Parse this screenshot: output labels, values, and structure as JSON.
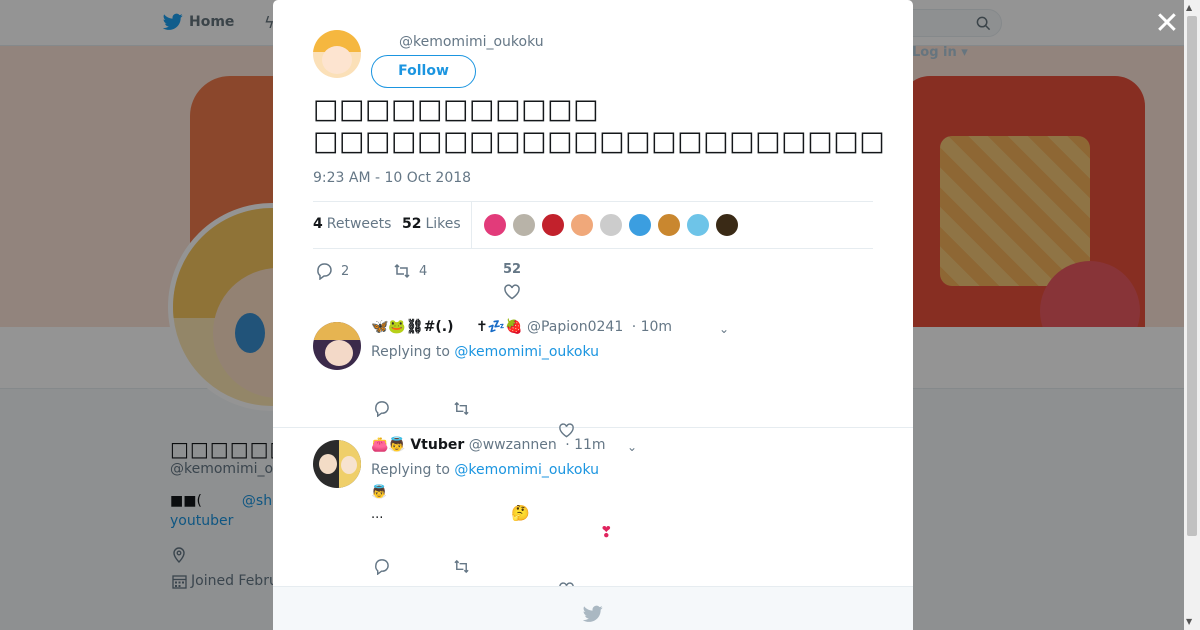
{
  "topbar": {
    "home_label": "Home",
    "login_label": "Log in"
  },
  "profile": {
    "name": "□□□□□□□□□□□",
    "handle": "@kemomimi_o",
    "bio_start": "■■(",
    "bio_link": "@she",
    "bio_line2": "youtuber",
    "joined": "Joined Febru"
  },
  "tweet": {
    "handle": "@kemomimi_oukoku",
    "follow_label": "Follow",
    "text": "□□□□□□□□□□□\n□□□□□□□□□□□□□□□□□□□□□□",
    "timestamp": "9:23 AM - 10 Oct 2018",
    "retweets_count": "4",
    "retweets_label": "Retweets",
    "likes_count": "52",
    "likes_label": "Likes",
    "liker_colors": [
      "#e23b7a",
      "#b8b3a8",
      "#c2212c",
      "#f0a87a",
      "#cccccc",
      "#3b9ee0",
      "#c9872f",
      "#6ec4e8",
      "#3a2a16"
    ],
    "actions": {
      "reply_count": "2",
      "retweet_count": "4",
      "like_count": "52"
    }
  },
  "replies": [
    {
      "name_emoji": "🦋🐸⛓#(.)",
      "name_tail": "✝💤🍓",
      "handle": "@Papion0241",
      "time": "· 10m",
      "replying_prefix": "Replying to",
      "mention": "@kemomimi_oukoku"
    },
    {
      "name_emoji": "👛👼",
      "name": "Vtuber",
      "handle": "@wwzannen",
      "time": "· 11m",
      "replying_prefix": "Replying to",
      "mention": "@kemomimi_oukoku",
      "body_emoji": "👼",
      "body_text": "...",
      "body_emoji2": "🤔",
      "body_emoji3": "❣"
    }
  ],
  "colors": {
    "accent": "#1b95e0",
    "twitter_blue": "#1da1f2",
    "muted": "#657786"
  }
}
